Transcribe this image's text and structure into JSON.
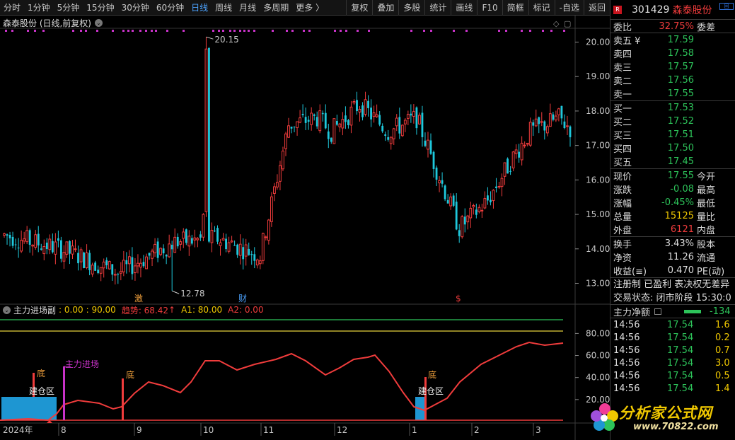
{
  "toolbar": {
    "periods": [
      "分时",
      "1分钟",
      "5分钟",
      "15分钟",
      "30分钟",
      "60分钟",
      "日线",
      "周线",
      "月线",
      "多周期",
      "更多 〉"
    ],
    "active_index": 6,
    "tools": [
      "复权",
      "叠加",
      "多股",
      "统计",
      "画线",
      "F10",
      "简框",
      "标记",
      "-自选",
      "返回"
    ]
  },
  "chart": {
    "title": "森泰股份 (日线,前复权)",
    "high_label": "20.15",
    "low_label": "12.78",
    "price_ticks": [
      "20.00",
      "19.00",
      "18.00",
      "17.00",
      "16.00",
      "15.00",
      "14.00",
      "13.00"
    ],
    "event_markers": [
      "激",
      "财",
      "$"
    ],
    "date_labels": [
      "2024年",
      "8",
      "9",
      "10",
      "11",
      "12",
      "1",
      "2",
      "3"
    ]
  },
  "indicator": {
    "name": "主力进场副",
    "v1": ": 0.00",
    "v2": ": 90.00",
    "trend_label": "趋势: 68.42",
    "trend_arrow": "↑",
    "a1": "A1: 80.00",
    "a2": "A2: 0.00",
    "ticks": [
      "80.00",
      "60.00",
      "40.00",
      "20.00"
    ],
    "labels": {
      "bottom1": "底",
      "bottom2": "底",
      "bottom3": "底",
      "zone1": "建仓区",
      "zone2": "建仓区",
      "enter": "主力进场"
    }
  },
  "quote": {
    "badge": "R",
    "code": "301429",
    "name": "森泰股份",
    "webi_label": "委比",
    "webi_value": "32.75%",
    "weicha_label": "委差",
    "asks": [
      {
        "label": "卖五 ¥",
        "price": "17.59"
      },
      {
        "label": "卖四",
        "price": "17.58"
      },
      {
        "label": "卖三",
        "price": "17.57"
      },
      {
        "label": "卖二",
        "price": "17.56"
      },
      {
        "label": "卖一",
        "price": "17.55"
      }
    ],
    "bids": [
      {
        "label": "买一",
        "price": "17.53"
      },
      {
        "label": "买二",
        "price": "17.52"
      },
      {
        "label": "买三",
        "price": "17.51"
      },
      {
        "label": "买四",
        "price": "17.50"
      },
      {
        "label": "买五",
        "price": "17.45"
      }
    ],
    "stats1": [
      {
        "label": "现价",
        "value": "17.55",
        "color": "green",
        "label2": "今开"
      },
      {
        "label": "涨跌",
        "value": "-0.08",
        "color": "green",
        "label2": "最高"
      },
      {
        "label": "涨幅",
        "value": "-0.45%",
        "color": "green",
        "label2": "最低"
      },
      {
        "label": "总量",
        "value": "15125",
        "color": "yellow",
        "label2": "量比"
      },
      {
        "label": "外盘",
        "value": "6121",
        "color": "red",
        "label2": "内盘"
      }
    ],
    "stats2": [
      {
        "label": "换手",
        "value": "3.43%",
        "color": "white",
        "label2": "股本"
      },
      {
        "label": "净资",
        "value": "11.26",
        "color": "white",
        "label2": "流通"
      },
      {
        "label": "收益(≡)",
        "value": "0.470",
        "color": "white",
        "label2": "PE(动)"
      }
    ],
    "tags": "注册制 已盈利 表决权无差异",
    "trade_status": "交易状态: 闭市阶段 15:30:0",
    "net_label": "主力净额",
    "net_value": "-134",
    "ticks": [
      {
        "time": "14:56",
        "price": "17.54",
        "vol": "1.6"
      },
      {
        "time": "14:56",
        "price": "17.54",
        "vol": "0.2"
      },
      {
        "time": "14:56",
        "price": "17.54",
        "vol": "0.7"
      },
      {
        "time": "14:56",
        "price": "17.54",
        "vol": "3.0"
      },
      {
        "time": "14:56",
        "price": "17.54",
        "vol": "0.5"
      },
      {
        "time": "14:56",
        "price": "17.54",
        "vol": "1.4"
      }
    ]
  },
  "watermark": {
    "text": "分析家公式网",
    "url": "www.70822.com"
  },
  "colors": {
    "up": "#f03c3c",
    "down": "#1ec8dc",
    "green_line": "#2dc35a",
    "yellow_line": "#e6d23c",
    "zone": "#1e96d2",
    "purple": "#c832c8",
    "marker_dots": "#c832c8"
  }
}
